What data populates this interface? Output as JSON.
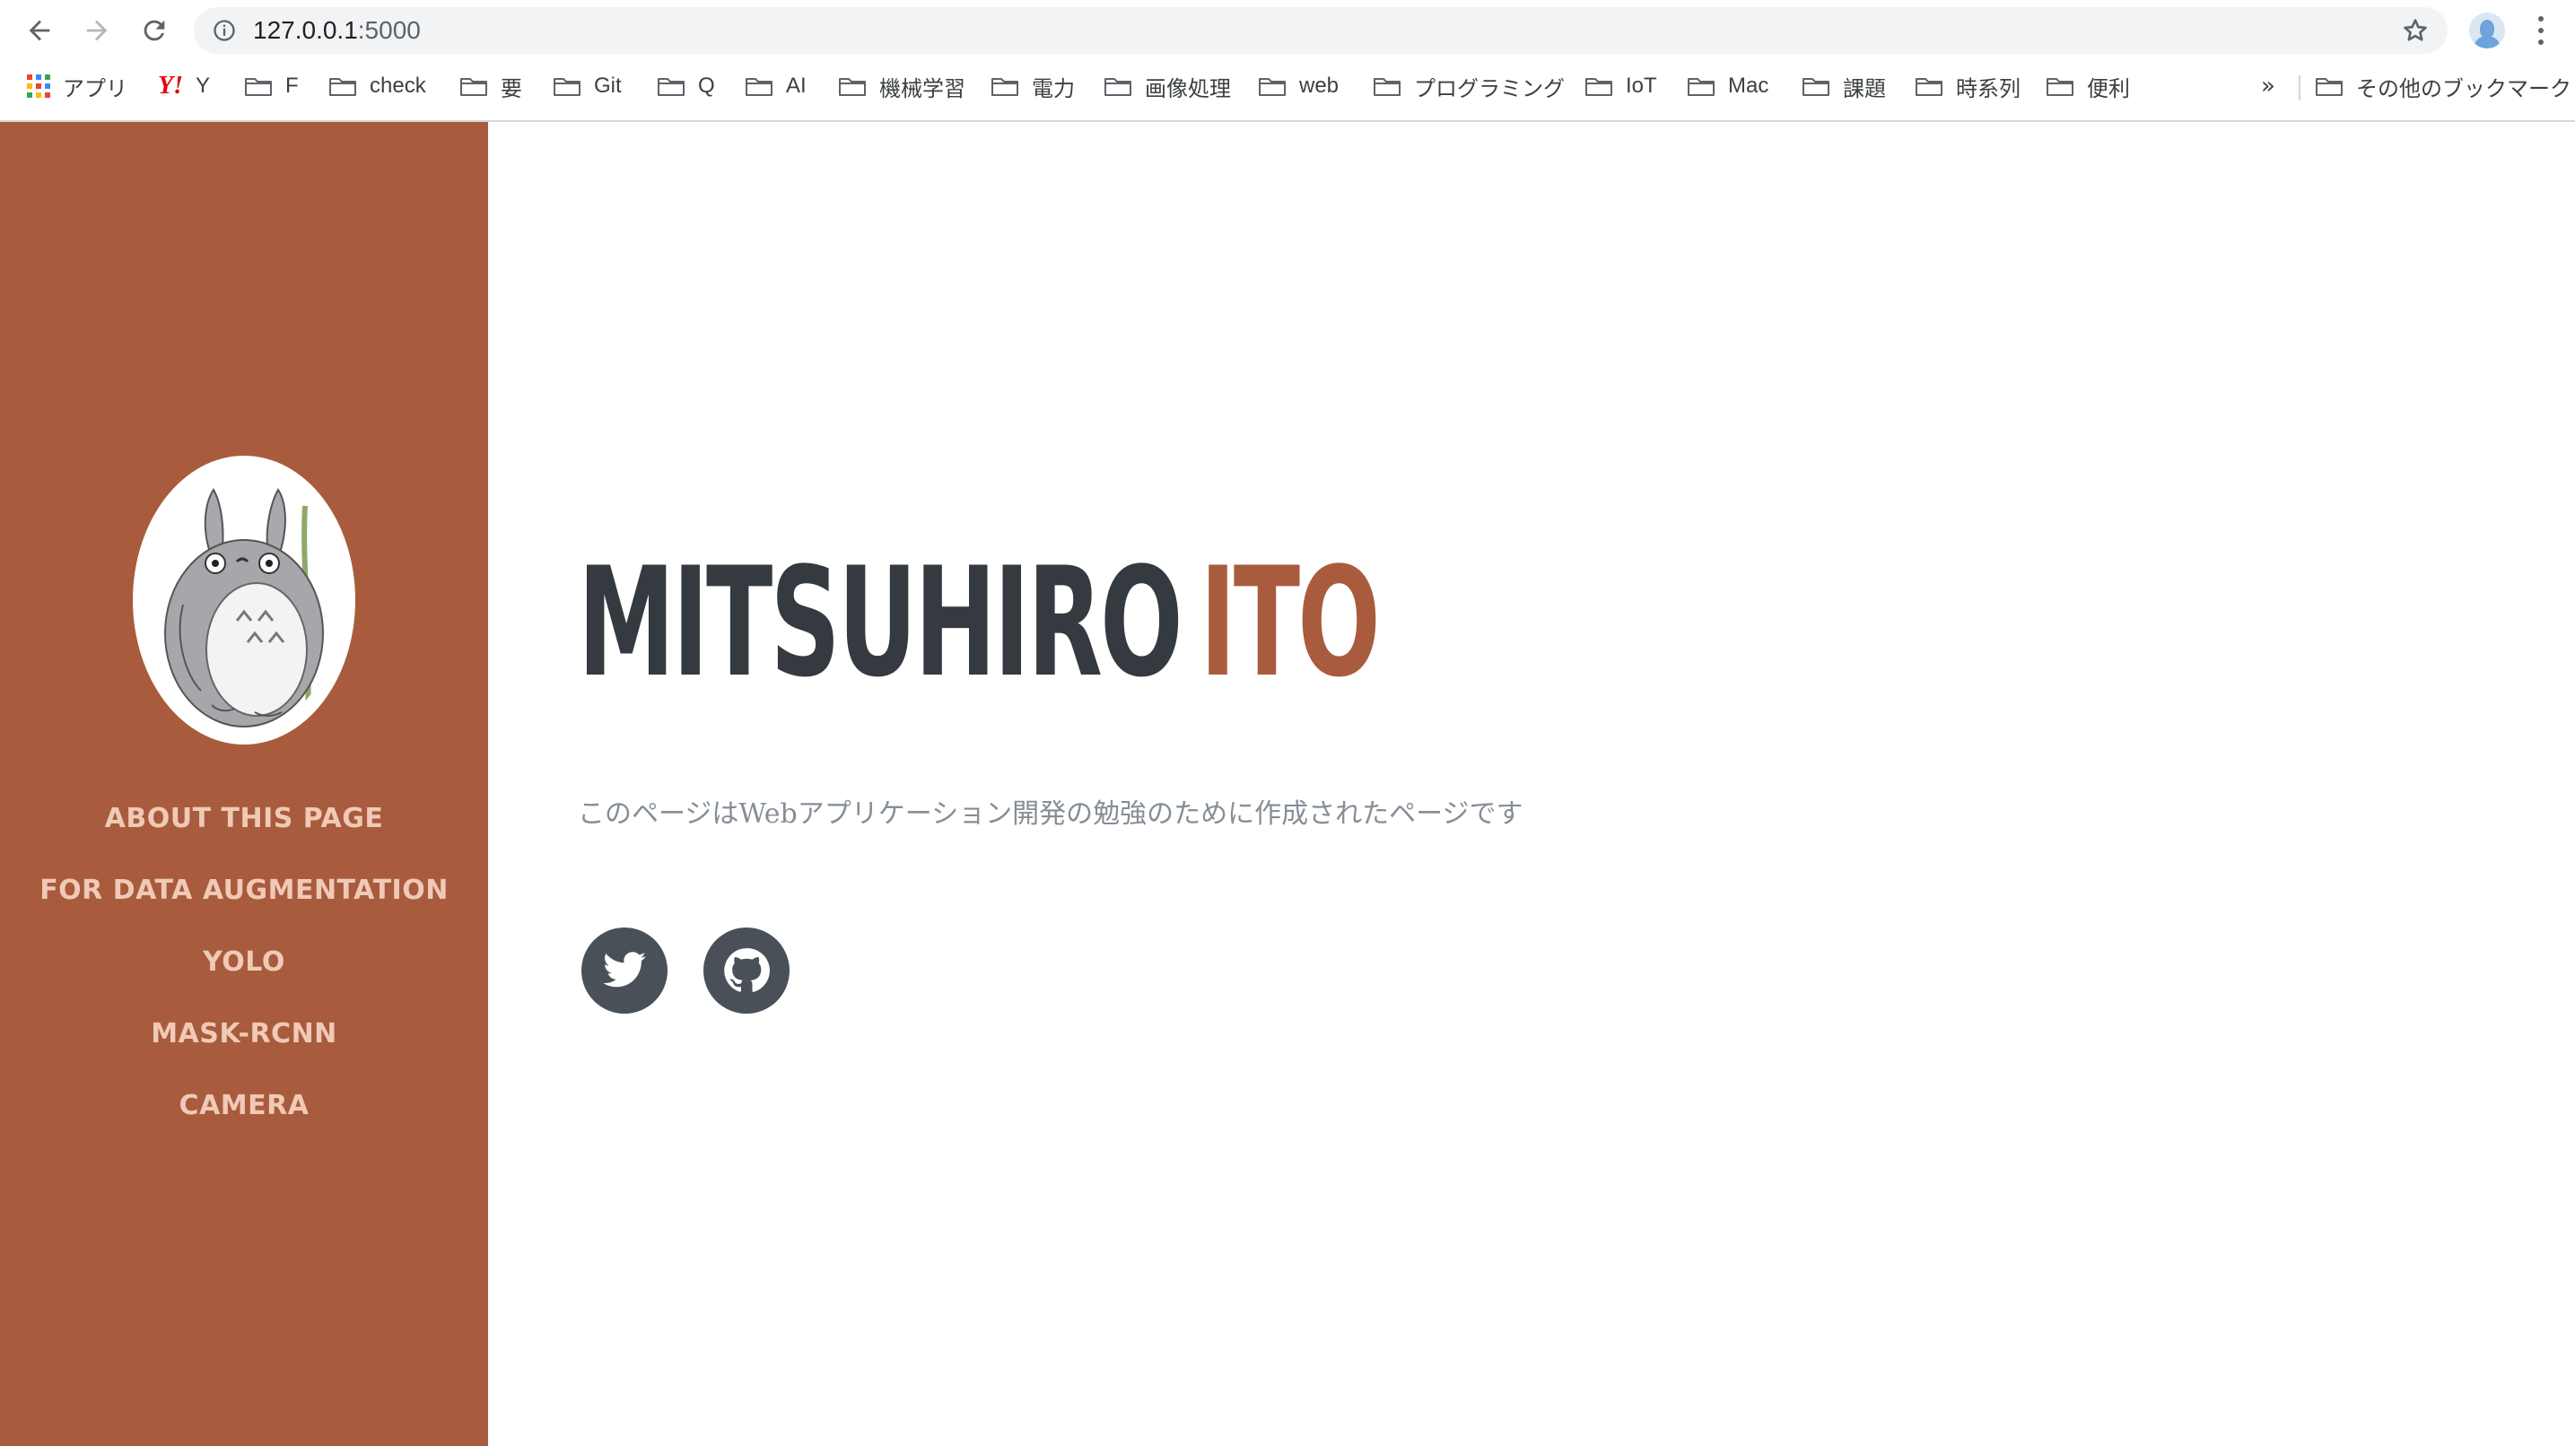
{
  "browser": {
    "url_host": "127.0.0.1",
    "url_port": ":5000",
    "bookmarks": [
      {
        "label": "アプリ",
        "icon": "apps-grid-icon"
      },
      {
        "label": "Y",
        "icon": "yahoo-icon",
        "icon_text": "Y!"
      },
      {
        "label": "F",
        "icon": "folder-icon"
      },
      {
        "label": "check",
        "icon": "folder-icon"
      },
      {
        "label": "要",
        "icon": "folder-icon"
      },
      {
        "label": "Git",
        "icon": "folder-icon"
      },
      {
        "label": "Q",
        "icon": "folder-icon"
      },
      {
        "label": "AI",
        "icon": "folder-icon"
      },
      {
        "label": "機械学習",
        "icon": "folder-icon"
      },
      {
        "label": "電力",
        "icon": "folder-icon"
      },
      {
        "label": "画像処理",
        "icon": "folder-icon"
      },
      {
        "label": "web",
        "icon": "folder-icon"
      },
      {
        "label": "プログラミング",
        "icon": "folder-icon"
      },
      {
        "label": "IoT",
        "icon": "folder-icon"
      },
      {
        "label": "Mac",
        "icon": "folder-icon"
      },
      {
        "label": "課題",
        "icon": "folder-icon"
      },
      {
        "label": "時系列",
        "icon": "folder-icon"
      },
      {
        "label": "便利",
        "icon": "folder-icon"
      }
    ],
    "overflow_label": "»",
    "other_bookmarks": "その他のブックマーク"
  },
  "sidebar": {
    "nav": [
      {
        "label": "ABOUT THIS PAGE"
      },
      {
        "label": "FOR DATA AUGMENTATION"
      },
      {
        "label": "YOLO"
      },
      {
        "label": "MASK-RCNN"
      },
      {
        "label": "CAMERA"
      }
    ]
  },
  "main": {
    "first_name": "MITSUHIRO",
    "last_name": "ITO",
    "lead": "このページはWebアプリケーション開発の勉強のために作成されたページです",
    "social": [
      {
        "icon": "twitter-icon"
      },
      {
        "icon": "github-icon"
      }
    ]
  },
  "colors": {
    "primary": "#a85c3d",
    "nav_text": "#f0c9b7",
    "dark": "#343a40",
    "muted": "#868e96",
    "social_bg": "#495057"
  }
}
